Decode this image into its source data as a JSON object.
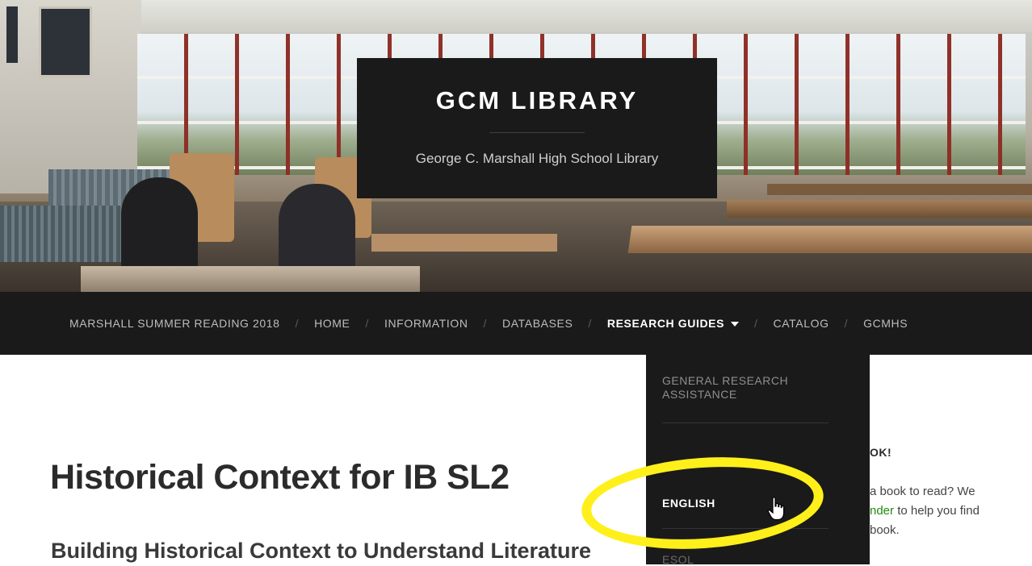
{
  "header": {
    "site_title": "GCM LIBRARY",
    "tagline": "George C. Marshall High School Library"
  },
  "nav": {
    "items": [
      {
        "label": "MARSHALL SUMMER READING 2018"
      },
      {
        "label": "HOME"
      },
      {
        "label": "INFORMATION"
      },
      {
        "label": "DATABASES"
      },
      {
        "label": "RESEARCH GUIDES",
        "active": true,
        "has_dropdown": true
      },
      {
        "label": "CATALOG"
      },
      {
        "label": "GCMHS"
      }
    ],
    "separator": "/"
  },
  "dropdown": {
    "items": [
      {
        "label": "GENERAL RESEARCH ASSISTANCE"
      },
      {
        "label": "ENGLISH",
        "hovered": true
      },
      {
        "label": "ESOL"
      }
    ]
  },
  "main": {
    "post_title": "Historical Context for IB SL2",
    "post_subtitle": "Building Historical Context to Understand Literature"
  },
  "sidebar": {
    "widget_title": "OK!",
    "text_parts": [
      "a book to read? We ",
      "nder",
      " to help you find",
      "book."
    ]
  },
  "colors": {
    "dark_bg": "#1a1a1a",
    "link_green": "#24890d",
    "highlight_yellow": "#ffef1a"
  },
  "icons": {
    "cursor": "hand-pointer-icon",
    "dropdown_caret": "caret-down-icon"
  }
}
